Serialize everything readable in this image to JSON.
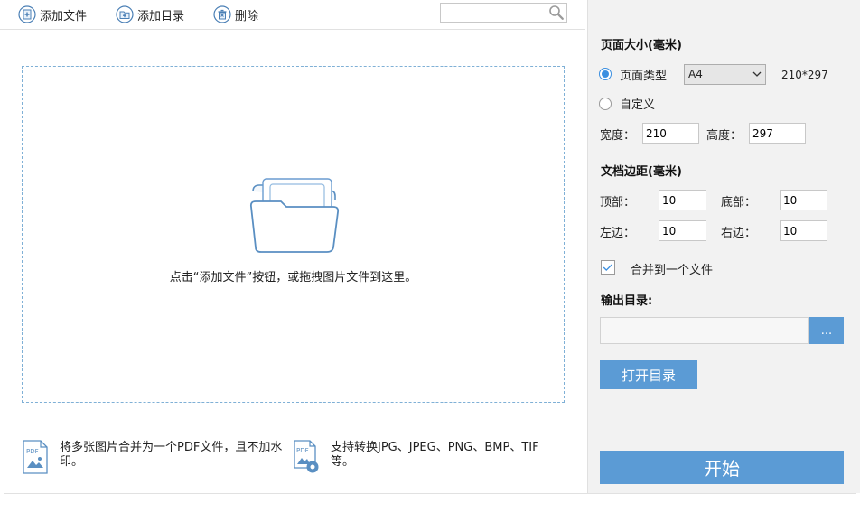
{
  "toolbar": {
    "add_file": "添加文件",
    "add_folder": "添加目录",
    "delete": "删除",
    "search_placeholder": ""
  },
  "dropzone": {
    "hint": "点击“添加文件”按钮，或拖拽图片文件到这里。"
  },
  "features": [
    {
      "text": "将多张图片合并为一个PDF文件，且不加水印。",
      "icon": "pdf-image-icon"
    },
    {
      "text": "支持转换JPG、JPEG、PNG、BMP、TIF等。",
      "icon": "pdf-settings-icon"
    }
  ],
  "panel": {
    "page_size_title": "页面大小(毫米)",
    "page_type_label": "页面类型",
    "page_type_value": "A4",
    "page_type_dims": "210*297",
    "custom_label": "自定义",
    "width_label": "宽度：",
    "width_value": "210",
    "height_label": "高度：",
    "height_value": "297",
    "margin_title": "文档边距(毫米)",
    "top_label": "顶部：",
    "top_value": "10",
    "bottom_label": "底部：",
    "bottom_value": "10",
    "left_label": "左边：",
    "left_value": "10",
    "right_label": "右边：",
    "right_value": "10",
    "merge_label": "合并到一个文件",
    "merge_checked": true,
    "output_title": "输出目录:",
    "output_value": "",
    "browse_label": "...",
    "open_dir_label": "打开目录",
    "start_label": "开始"
  },
  "colors": {
    "accent": "#5b9bd5",
    "dash_border": "#7fb0d6",
    "panel_bg": "#f2f2f2"
  }
}
